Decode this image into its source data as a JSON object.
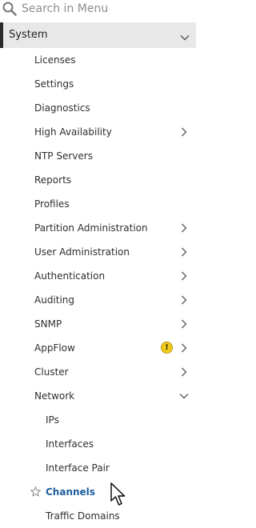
{
  "search": {
    "placeholder": "Search in Menu"
  },
  "section": {
    "label": "System",
    "expanded": true
  },
  "items": [
    {
      "label": "Licenses",
      "level": 1,
      "has_children": false
    },
    {
      "label": "Settings",
      "level": 1,
      "has_children": false
    },
    {
      "label": "Diagnostics",
      "level": 1,
      "has_children": false
    },
    {
      "label": "High Availability",
      "level": 1,
      "has_children": true
    },
    {
      "label": "NTP Servers",
      "level": 1,
      "has_children": false
    },
    {
      "label": "Reports",
      "level": 1,
      "has_children": false
    },
    {
      "label": "Profiles",
      "level": 1,
      "has_children": false
    },
    {
      "label": "Partition Administration",
      "level": 1,
      "has_children": true
    },
    {
      "label": "User Administration",
      "level": 1,
      "has_children": true
    },
    {
      "label": "Authentication",
      "level": 1,
      "has_children": true
    },
    {
      "label": "Auditing",
      "level": 1,
      "has_children": true
    },
    {
      "label": "SNMP",
      "level": 1,
      "has_children": true
    },
    {
      "label": "AppFlow",
      "level": 1,
      "has_children": true,
      "badge": "!"
    },
    {
      "label": "Cluster",
      "level": 1,
      "has_children": true
    },
    {
      "label": "Network",
      "level": 1,
      "has_children": true,
      "expanded": true
    },
    {
      "label": "IPs",
      "level": 2,
      "has_children": false
    },
    {
      "label": "Interfaces",
      "level": 2,
      "has_children": false
    },
    {
      "label": "Interface Pair",
      "level": 2,
      "has_children": false
    },
    {
      "label": "Channels",
      "level": 2,
      "has_children": false,
      "active": true,
      "favorite_icon": "star-outline-icon"
    },
    {
      "label": "Traffic Domains",
      "level": 2,
      "has_children": false
    }
  ],
  "colors": {
    "active_text": "#1f5e9e",
    "section_bg": "#e8e8e8",
    "warning_badge": "#f2cb1d"
  }
}
